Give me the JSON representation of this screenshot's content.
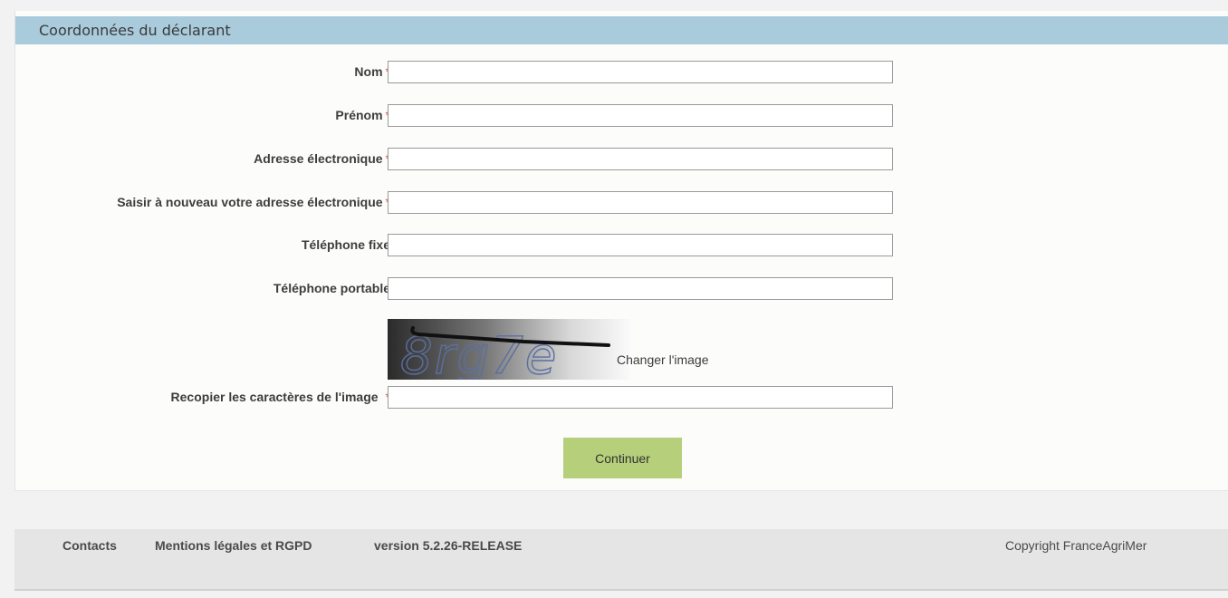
{
  "section": {
    "title": "Coordonnées du déclarant"
  },
  "form": {
    "required_marker": "*",
    "fields": [
      {
        "label": "Nom",
        "required": true,
        "value": ""
      },
      {
        "label": "Prénom",
        "required": true,
        "value": ""
      },
      {
        "label": "Adresse électronique",
        "required": true,
        "value": ""
      },
      {
        "label": "Saisir à nouveau votre adresse électronique",
        "required": true,
        "value": ""
      },
      {
        "label": "Téléphone fixe",
        "required": false,
        "value": ""
      },
      {
        "label": "Téléphone portable",
        "required": false,
        "value": ""
      }
    ],
    "captcha": {
      "image_text": "8rg7e",
      "change_label": "Changer l'image",
      "input_label": "Recopier les caractères de l'image",
      "value": ""
    },
    "submit_label": "Continuer"
  },
  "footer": {
    "contacts": "Contacts",
    "legal": "Mentions légales et RGPD",
    "version": "version 5.2.26-RELEASE",
    "copyright": "Copyright FranceAgriMer"
  },
  "colors": {
    "header": "#a9cbdc",
    "button": "#b5cf7a",
    "required": "#d9534f"
  }
}
